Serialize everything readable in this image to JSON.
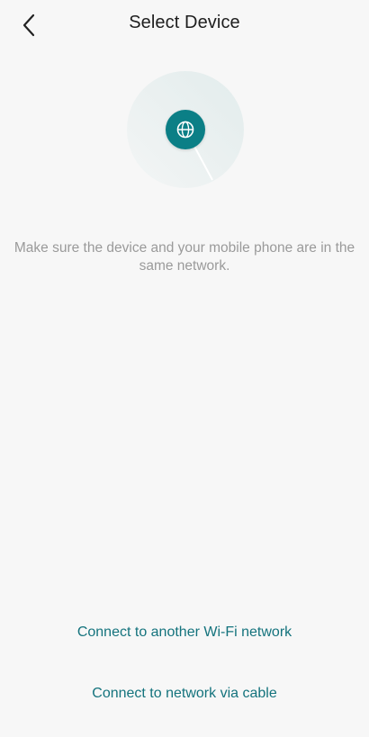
{
  "header": {
    "title": "Select Device"
  },
  "message": {
    "hint": "Make sure the device and your mobile phone are in the same network."
  },
  "actions": {
    "wifi_label": "Connect to another Wi-Fi network",
    "cable_label": "Connect to network via cable"
  },
  "colors": {
    "accent": "#0b7f86",
    "link": "#14737d",
    "background": "#f7f7f7"
  }
}
